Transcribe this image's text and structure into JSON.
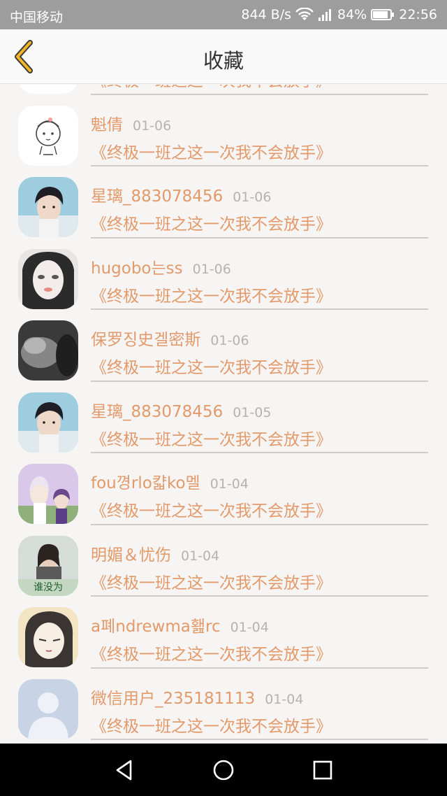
{
  "status_bar": {
    "carrier": "中国移动",
    "net_speed": "844 B/s",
    "battery": "84%",
    "time": "22:56"
  },
  "header": {
    "title": "收藏",
    "accent_color": "#f3b428"
  },
  "items": [
    {
      "name": "",
      "date": "",
      "book": "《终极一班之这一次我不会放手》",
      "avatar": "sketch"
    },
    {
      "name": "魁倩",
      "date": "01-06",
      "book": "《终极一班之这一次我不会放手》",
      "avatar": "sketch"
    },
    {
      "name": "星璃_883078456",
      "date": "01-06",
      "book": "《终极一班之这一次我不会放手》",
      "avatar": "boy"
    },
    {
      "name": "hugobo는ss",
      "date": "01-06",
      "book": "《终极一班之这一次我不会放手》",
      "avatar": "girl"
    },
    {
      "name": "保罗징史겔密斯",
      "date": "01-06",
      "book": "《终极一班之这一次我不会放手》",
      "avatar": "smoke"
    },
    {
      "name": "星璃_883078456",
      "date": "01-05",
      "book": "《终极一班之这一次我不会放手》",
      "avatar": "boy"
    },
    {
      "name": "fou꼉rlo캷ko멜",
      "date": "01-04",
      "book": "《终极一班之这一次我不会放手》",
      "avatar": "anime"
    },
    {
      "name": "明媚＆忧伤",
      "date": "01-04",
      "book": "《终极一班之这一次我不会放手》",
      "avatar": "photo"
    },
    {
      "name": "a폐ndrewma홾rc",
      "date": "01-04",
      "book": "《终极一班之这一次我不会放手》",
      "avatar": "drawing"
    },
    {
      "name": "微信用户_235181113",
      "date": "01-04",
      "book": "《终极一班之这一次我不会放手》",
      "avatar": "default"
    }
  ],
  "colors": {
    "name_text": "#e39a6a",
    "date_text": "#b3b3b3",
    "divider": "#cfcbcb"
  }
}
